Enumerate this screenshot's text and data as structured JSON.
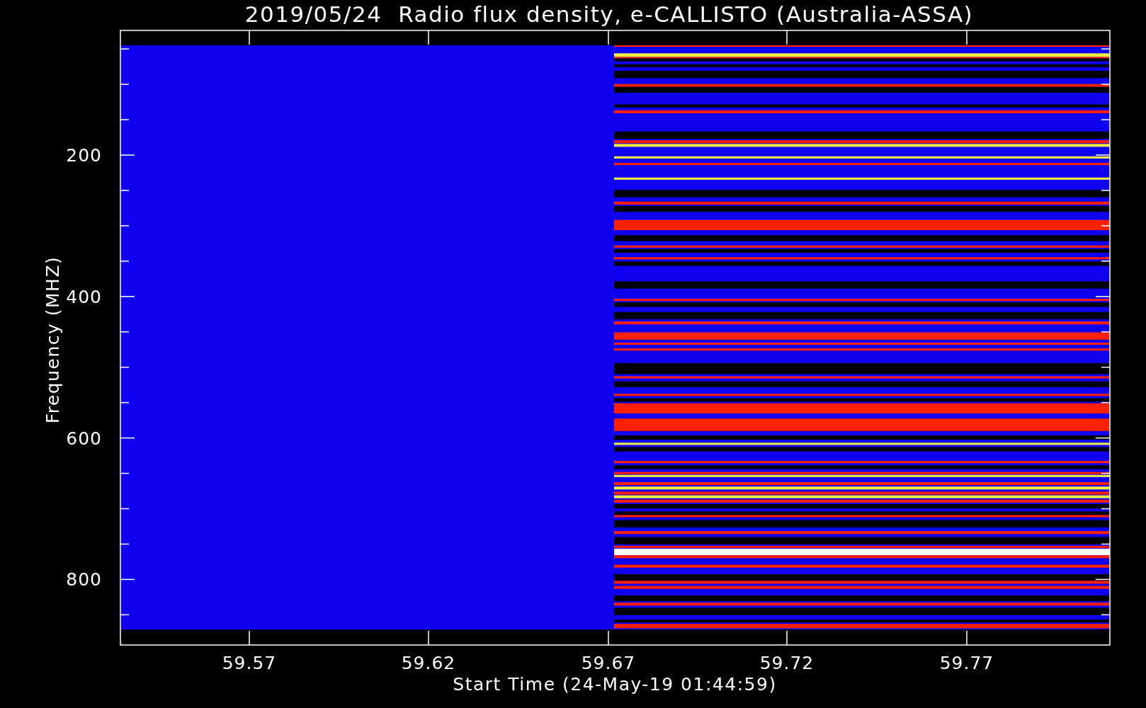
{
  "title": "2019/05/24  Radio flux density, e-CALLISTO (Australia-ASSA)",
  "y_axis": {
    "label": "Frequency (MHZ)",
    "ticks": [
      "200",
      "400",
      "600",
      "800"
    ]
  },
  "x_axis": {
    "label": "Start Time (24-May-19 01:44:59)",
    "ticks": [
      "59.57",
      "59.62",
      "59.67",
      "59.72",
      "59.77"
    ]
  }
}
